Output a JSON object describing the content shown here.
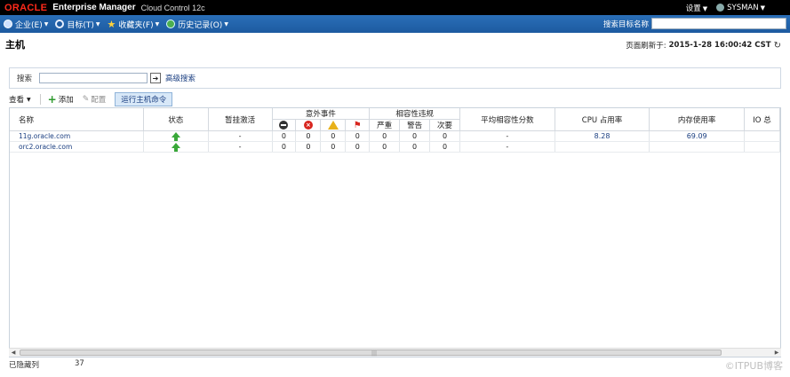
{
  "brand": {
    "logo": "ORACLE",
    "product": "Enterprise Manager",
    "version": "Cloud Control 12c"
  },
  "top_right": {
    "settings": "设置",
    "user": "SYSMAN"
  },
  "nav": {
    "items": [
      {
        "label": "企业(E)",
        "icon": "enterprise-icon"
      },
      {
        "label": "目标(T)",
        "icon": "target-icon"
      },
      {
        "label": "收藏夹(F)",
        "icon": "star-icon"
      },
      {
        "label": "历史记录(O)",
        "icon": "history-icon"
      }
    ],
    "search_label": "搜索目标名称",
    "search_value": ""
  },
  "page": {
    "title": "主机",
    "refresh_label": "页面刷新于:",
    "refresh_time": "2015-1-28 16:00:42 CST"
  },
  "search": {
    "label": "搜索",
    "value": "",
    "advanced": "高级搜索"
  },
  "toolbar": {
    "view": "查看",
    "add": "添加",
    "configure": "配置",
    "run_command": "运行主机命令"
  },
  "table": {
    "headers": {
      "name": "名称",
      "status": "状态",
      "blackout": "暂挂激活",
      "incidents": "意外事件",
      "compliance": "相容性违规",
      "critical": "严重",
      "warning": "警告",
      "minor": "次要",
      "avg_score": "平均相容性分数",
      "cpu": "CPU 占用率",
      "mem": "内存使用率",
      "io": "IO 总"
    },
    "rows": [
      {
        "name": "11g.oracle.com",
        "blackout": "-",
        "inc1": "0",
        "inc2": "0",
        "inc3": "0",
        "inc4": "0",
        "c1": "0",
        "c2": "0",
        "c3": "0",
        "score": "-",
        "cpu": "8.28",
        "mem": "69.09"
      },
      {
        "name": "orc2.oracle.com",
        "blackout": "-",
        "inc1": "0",
        "inc2": "0",
        "inc3": "0",
        "inc4": "0",
        "c1": "0",
        "c2": "0",
        "c3": "0",
        "score": "-",
        "cpu": "",
        "mem": ""
      }
    ]
  },
  "footer": {
    "hidden_cols_label": "已隐藏列",
    "hidden_cols_count": "37"
  },
  "watermark": "©ITPUB博客"
}
